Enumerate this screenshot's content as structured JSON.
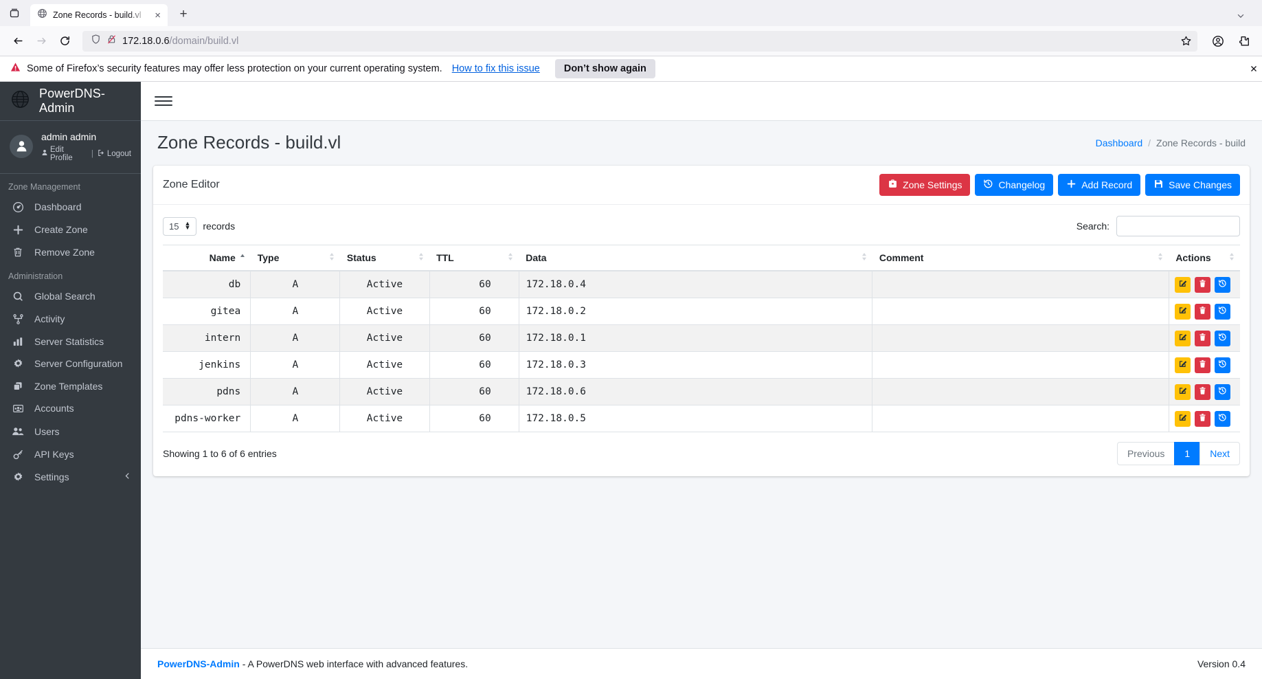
{
  "browser": {
    "tab": {
      "title": "Zone Records - build.vl",
      "favicon": "globe-icon",
      "close": "×"
    },
    "newtab_label": "+",
    "url": {
      "host": "172.18.0.6",
      "path": "/domain/build.vl"
    },
    "notification": {
      "text": "Some of Firefox’s security features may offer less protection on your current operating system.",
      "link": "How to fix this issue",
      "button": "Don’t show again"
    }
  },
  "sidebar": {
    "brand": "PowerDNS-Admin",
    "user": {
      "name": "admin admin",
      "edit_profile": "Edit Profile",
      "logout": "Logout",
      "separator": "|"
    },
    "sections": [
      {
        "heading": "Zone Management",
        "items": [
          {
            "label": "Dashboard",
            "icon": "dashboard-icon"
          },
          {
            "label": "Create Zone",
            "icon": "plus-icon"
          },
          {
            "label": "Remove Zone",
            "icon": "trash-icon"
          }
        ]
      },
      {
        "heading": "Administration",
        "items": [
          {
            "label": "Global Search",
            "icon": "search-icon"
          },
          {
            "label": "Activity",
            "icon": "sitemap-icon"
          },
          {
            "label": "Server Statistics",
            "icon": "bar-chart-icon"
          },
          {
            "label": "Server Configuration",
            "icon": "gear-icon"
          },
          {
            "label": "Zone Templates",
            "icon": "copy-icon"
          },
          {
            "label": "Accounts",
            "icon": "id-card-icon"
          },
          {
            "label": "Users",
            "icon": "users-icon"
          },
          {
            "label": "API Keys",
            "icon": "key-icon"
          },
          {
            "label": "Settings",
            "icon": "gear-icon",
            "caret": "chevron-left-icon"
          }
        ]
      }
    ]
  },
  "main": {
    "page_title": "Zone Records - build.vl",
    "breadcrumb": {
      "home": "Dashboard",
      "divider": "/",
      "current": "Zone Records - build"
    },
    "card": {
      "title": "Zone Editor",
      "buttons": [
        {
          "label": "Zone Settings",
          "icon": "toolbox-icon",
          "color": "#dc3545"
        },
        {
          "label": "Changelog",
          "icon": "history-icon",
          "color": "#007bff"
        },
        {
          "label": "Add Record",
          "icon": "plus-icon",
          "color": "#007bff"
        },
        {
          "label": "Save Changes",
          "icon": "save-icon",
          "color": "#007bff"
        }
      ]
    },
    "datatable": {
      "length_value": "15",
      "length_label": "records",
      "search_label": "Search:",
      "search_value": "",
      "search_placeholder": "",
      "columns": [
        {
          "label": "Name",
          "sorted": "asc"
        },
        {
          "label": "Type",
          "sorted": "none"
        },
        {
          "label": "Status",
          "sorted": "none"
        },
        {
          "label": "TTL",
          "sorted": "none"
        },
        {
          "label": "Data",
          "sorted": "none"
        },
        {
          "label": "Comment",
          "sorted": "none"
        },
        {
          "label": "Actions",
          "sorted": "none"
        }
      ],
      "rows": [
        {
          "name": "db",
          "type": "A",
          "status": "Active",
          "ttl": "60",
          "data": "172.18.0.4",
          "comment": ""
        },
        {
          "name": "gitea",
          "type": "A",
          "status": "Active",
          "ttl": "60",
          "data": "172.18.0.2",
          "comment": ""
        },
        {
          "name": "intern",
          "type": "A",
          "status": "Active",
          "ttl": "60",
          "data": "172.18.0.1",
          "comment": ""
        },
        {
          "name": "jenkins",
          "type": "A",
          "status": "Active",
          "ttl": "60",
          "data": "172.18.0.3",
          "comment": ""
        },
        {
          "name": "pdns",
          "type": "A",
          "status": "Active",
          "ttl": "60",
          "data": "172.18.0.6",
          "comment": ""
        },
        {
          "name": "pdns-worker",
          "type": "A",
          "status": "Active",
          "ttl": "60",
          "data": "172.18.0.5",
          "comment": ""
        }
      ],
      "row_actions": [
        {
          "name": "edit-record-button",
          "icon": "pencil-square-icon"
        },
        {
          "name": "delete-record-button",
          "icon": "trash-icon"
        },
        {
          "name": "record-history-button",
          "icon": "history-icon"
        }
      ],
      "info": "Showing 1 to 6 of 6 entries",
      "pagination": {
        "previous": "Previous",
        "pages": [
          "1"
        ],
        "next": "Next",
        "current": "1"
      }
    }
  },
  "footer": {
    "brand": "PowerDNS-Admin",
    "tagline": "- A PowerDNS web interface with advanced features.",
    "version": "Version 0.4"
  },
  "colors": {
    "sidebar_bg": "#343a40",
    "primary": "#007bff",
    "danger": "#dc3545",
    "warning": "#ffc107",
    "content_bg": "#f4f6f9"
  }
}
